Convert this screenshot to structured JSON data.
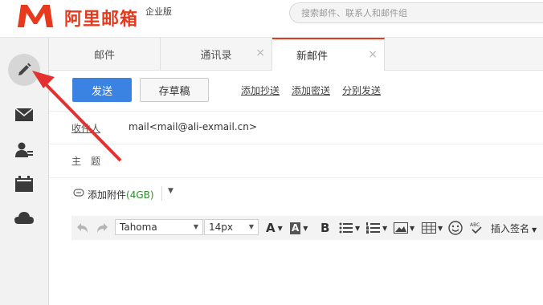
{
  "brand": {
    "name": "阿里邮箱",
    "edition": "企业版",
    "accent": "#e8391d"
  },
  "search": {
    "placeholder": "搜索邮件、联系人和邮件组"
  },
  "sidebar": {
    "items": [
      {
        "icon": "pencil-icon",
        "label": "compose"
      },
      {
        "icon": "envelope-icon",
        "label": "mail"
      },
      {
        "icon": "contacts-icon",
        "label": "contacts"
      },
      {
        "icon": "calendar-icon",
        "label": "calendar"
      },
      {
        "icon": "cloud-icon",
        "label": "cloud"
      }
    ]
  },
  "tabs": [
    {
      "label": "邮件",
      "closable": false,
      "active": false
    },
    {
      "label": "通讯录",
      "closable": true,
      "active": false
    },
    {
      "label": "新邮件",
      "closable": true,
      "active": true
    }
  ],
  "compose": {
    "send_label": "发送",
    "save_draft_label": "存草稿",
    "add_cc": "添加抄送",
    "add_bcc": "添加密送",
    "separate_send": "分别发送",
    "to_label": "收件人",
    "to_value": "mail<mail@ali-exmail.cn>",
    "subject_label": "主　题",
    "subject_value": "",
    "attach_label": "添加附件",
    "attach_size": "(4GB)"
  },
  "editor": {
    "font_family": "Tahoma",
    "font_size": "14px",
    "insert_signature": "插入签名"
  },
  "colors": {
    "send_button": "#3b83e2",
    "attach_size": "#2f8a2f"
  }
}
